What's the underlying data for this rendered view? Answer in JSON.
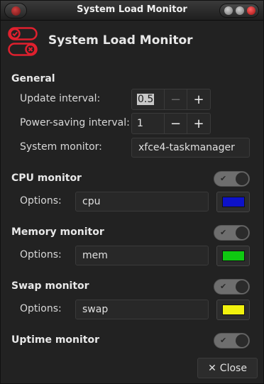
{
  "window": {
    "title": "System Load Monitor"
  },
  "header": {
    "title": "System Load Monitor"
  },
  "general": {
    "title": "General",
    "update_interval": {
      "label": "Update interval:",
      "value": "0.5",
      "minus": "−",
      "plus": "+"
    },
    "power_saving_interval": {
      "label": "Power-saving interval:",
      "value": "1",
      "minus": "−",
      "plus": "+"
    },
    "system_monitor": {
      "label": "System monitor:",
      "value": "xfce4-taskmanager"
    }
  },
  "cpu": {
    "title": "CPU monitor",
    "enabled": true,
    "options_label": "Options:",
    "options_value": "cpu",
    "color": "#0d12c9"
  },
  "memory": {
    "title": "Memory monitor",
    "enabled": true,
    "options_label": "Options:",
    "options_value": "mem",
    "color": "#0fc811"
  },
  "swap": {
    "title": "Swap monitor",
    "enabled": true,
    "options_label": "Options:",
    "options_value": "swap",
    "color": "#f2f20e"
  },
  "uptime": {
    "title": "Uptime monitor",
    "enabled": true
  },
  "toggle_check": "✔",
  "footer": {
    "close_icon": "✕",
    "close_label": "Close"
  }
}
